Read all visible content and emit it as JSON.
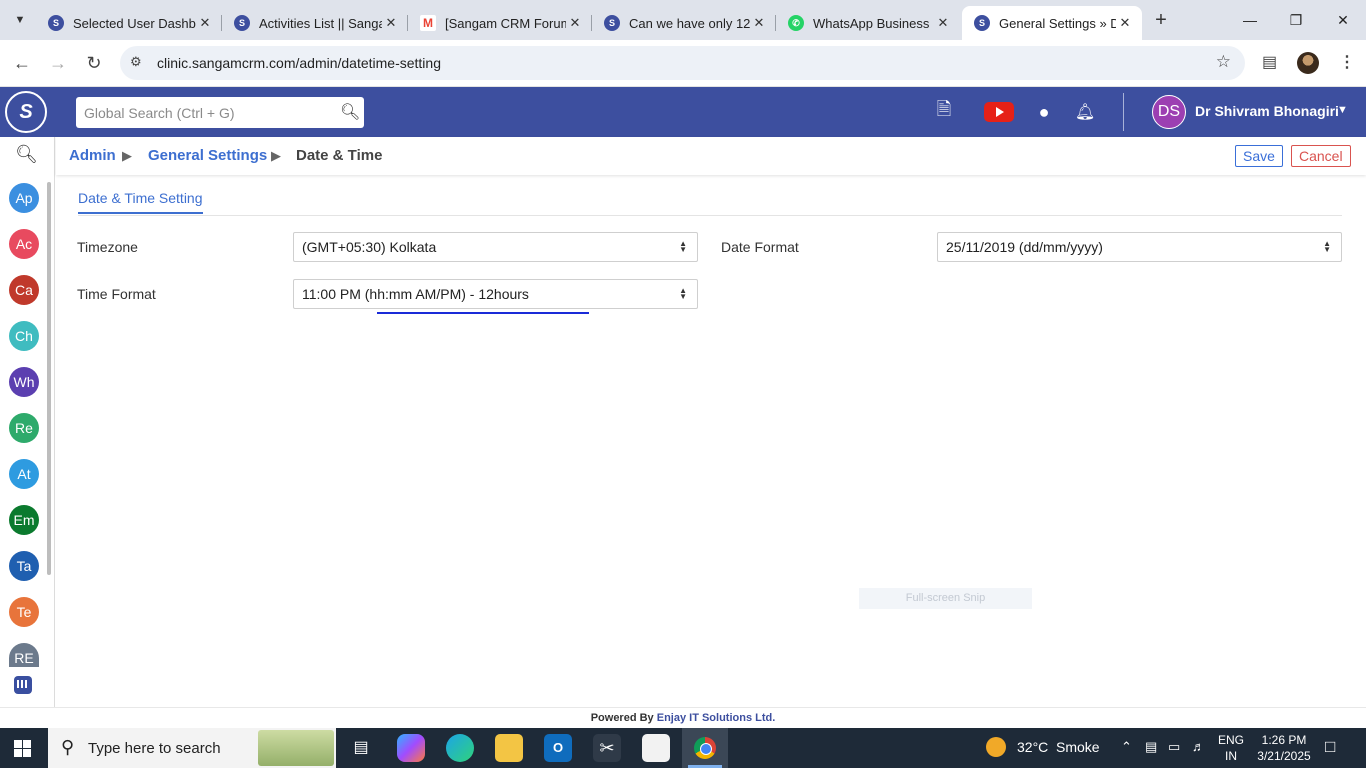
{
  "browser": {
    "tabs": [
      {
        "title": "Selected User Dashbo",
        "favicon": "sangam-icon",
        "color": "#3d4f9f"
      },
      {
        "title": "Activities List || Sanga",
        "favicon": "sangam-icon",
        "color": "#3d4f9f"
      },
      {
        "title": "[Sangam CRM Forum",
        "favicon": "gmail-icon",
        "color": "#ea4335"
      },
      {
        "title": "Can we have only 12",
        "favicon": "sangam-icon",
        "color": "#3d4f9f"
      },
      {
        "title": "WhatsApp Business",
        "favicon": "whatsapp-icon",
        "color": "#25d366"
      },
      {
        "title": "General Settings » Da",
        "favicon": "sangam-icon",
        "color": "#3d4f9f"
      }
    ],
    "url": "clinic.sangamcrm.com/admin/datetime-setting"
  },
  "header": {
    "search_placeholder": "Global Search (Ctrl + G)",
    "user_initials": "DS",
    "user_name": "Dr Shivram Bhonagiri"
  },
  "sidebar": {
    "items": [
      {
        "label": "Ap",
        "color": "#3b8fe0"
      },
      {
        "label": "Ac",
        "color": "#e84a5f"
      },
      {
        "label": "Ca",
        "color": "#c0392b"
      },
      {
        "label": "Ch",
        "color": "#3fbcc0"
      },
      {
        "label": "Wh",
        "color": "#5b3fb0"
      },
      {
        "label": "Re",
        "color": "#2eaa6b"
      },
      {
        "label": "At",
        "color": "#2e9be0"
      },
      {
        "label": "Em",
        "color": "#0b7a2e"
      },
      {
        "label": "Ta",
        "color": "#1f5fb0"
      },
      {
        "label": "Te",
        "color": "#e8743b"
      },
      {
        "label": "RE",
        "color": "#6c7a8c"
      }
    ]
  },
  "breadcrumb": {
    "admin": "Admin",
    "general": "General Settings",
    "current": "Date & Time"
  },
  "actions": {
    "save": "Save",
    "cancel": "Cancel"
  },
  "section_title": "Date & Time Setting",
  "form": {
    "timezone_label": "Timezone",
    "timezone_value": "(GMT+05:30) Kolkata",
    "date_format_label": "Date Format",
    "date_format_value": "25/11/2019 (dd/mm/yyyy)",
    "time_format_label": "Time Format",
    "time_format_value": "11:00 PM (hh:mm AM/PM) - 12hours"
  },
  "overlay": {
    "snip_text": "Full-screen Snip"
  },
  "footer": {
    "powered": "Powered By ",
    "company": "Enjay IT Solutions Ltd."
  },
  "taskbar": {
    "search_text": "Type here to search",
    "temperature": "32°C",
    "weather": "Smoke",
    "lang_top": "ENG",
    "lang_bottom": "IN",
    "time": "1:26 PM",
    "date": "3/21/2025"
  }
}
